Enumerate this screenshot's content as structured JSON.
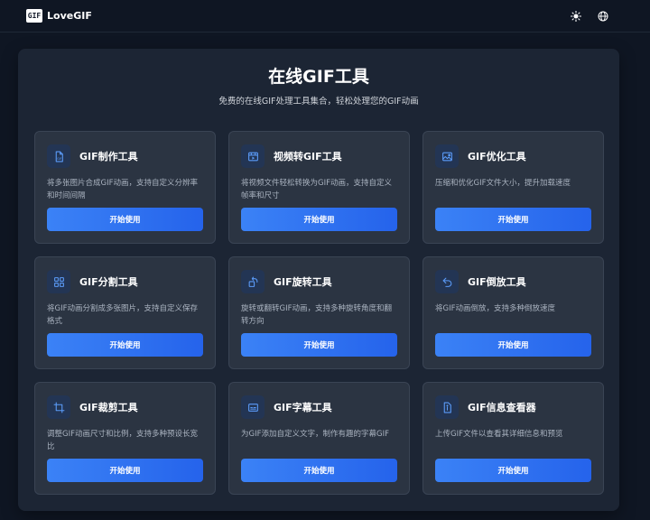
{
  "header": {
    "logo_text": "GIF",
    "brand": "LoveGIF",
    "theme_icon": "sun-icon",
    "language_icon": "globe-icon"
  },
  "main": {
    "title": "在线GIF工具",
    "subtitle": "免费的在线GIF处理工具集合，轻松处理您的GIF动画"
  },
  "colors": {
    "accent": "#3b82f6",
    "background": "#0f1623",
    "card": "#2b3442"
  },
  "tools": [
    {
      "icon": "file-gif-icon",
      "title": "GIF制作工具",
      "description": "将多张图片合成GIF动画，支持自定义分辨率和时间间隔",
      "button": "开始使用"
    },
    {
      "icon": "video-icon",
      "title": "视频转GIF工具",
      "description": "将视频文件轻松转换为GIF动画，支持自定义帧率和尺寸",
      "button": "开始使用"
    },
    {
      "icon": "image-icon",
      "title": "GIF优化工具",
      "description": "压缩和优化GIF文件大小，提升加载速度",
      "button": "开始使用"
    },
    {
      "icon": "split-icon",
      "title": "GIF分割工具",
      "description": "将GIF动画分割成多张图片，支持自定义保存格式",
      "button": "开始使用"
    },
    {
      "icon": "rotate-icon",
      "title": "GIF旋转工具",
      "description": "旋转或翻转GIF动画，支持多种旋转角度和翻转方向",
      "button": "开始使用"
    },
    {
      "icon": "undo-icon",
      "title": "GIF倒放工具",
      "description": "将GIF动画倒放，支持多种倒放速度",
      "button": "开始使用"
    },
    {
      "icon": "crop-icon",
      "title": "GIF裁剪工具",
      "description": "调整GIF动画尺寸和比例，支持多种预设长宽比",
      "button": "开始使用"
    },
    {
      "icon": "subtitle-icon",
      "title": "GIF字幕工具",
      "description": "为GIF添加自定义文字，制作有趣的字幕GIF",
      "button": "开始使用"
    },
    {
      "icon": "info-icon",
      "title": "GIF信息查看器",
      "description": "上传GIF文件以查看其详细信息和预览",
      "button": "开始使用"
    }
  ]
}
